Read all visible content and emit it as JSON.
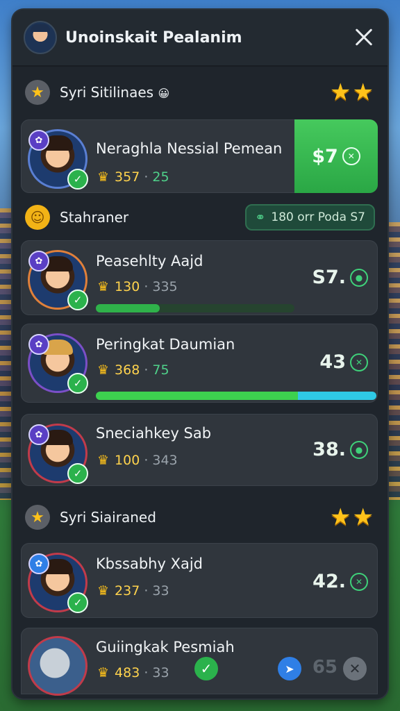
{
  "header": {
    "title": "Unoinskait Pealanim"
  },
  "sections": [
    {
      "label": "Syri Sitilinaes",
      "emoji": "😀"
    },
    {
      "label": "Stahraner",
      "pill": "180 orr Poda S7"
    },
    {
      "label": "Syri Siairaned"
    }
  ],
  "players": [
    {
      "name": "Neraghla Nessial Pemean",
      "stat_a": "357",
      "stat_b": "25",
      "price": "$7"
    },
    {
      "name": "Peasehlty Aajd",
      "stat_a": "130",
      "stat_b": "335",
      "price": "S7.",
      "progress": 0.32
    },
    {
      "name": "Peringkat Daumian",
      "stat_a": "368",
      "stat_b": "75",
      "price": "43",
      "progress": 1.0
    },
    {
      "name": "Sneciahkey Sab",
      "stat_a": "100",
      "stat_b": "343",
      "price": "38."
    },
    {
      "name": "Kbssabhy Xajd",
      "stat_a": "237",
      "stat_b": "33",
      "price": "42."
    }
  ],
  "bottom": {
    "name": "Guiingkak Pesmiah",
    "stat_a": "483",
    "stat_b": "33",
    "price": "65"
  },
  "icons": {
    "crown": "crown-icon",
    "check": "check-icon",
    "close": "close-icon",
    "star": "star-icon",
    "smile": "smile-icon",
    "link": "link-icon",
    "compass": "compass-icon",
    "cancel": "cancel-icon"
  },
  "colors": {
    "accent_green": "#2fb24a",
    "gold": "#ffc21a",
    "panel": "#1f252c",
    "card": "#30363d"
  }
}
